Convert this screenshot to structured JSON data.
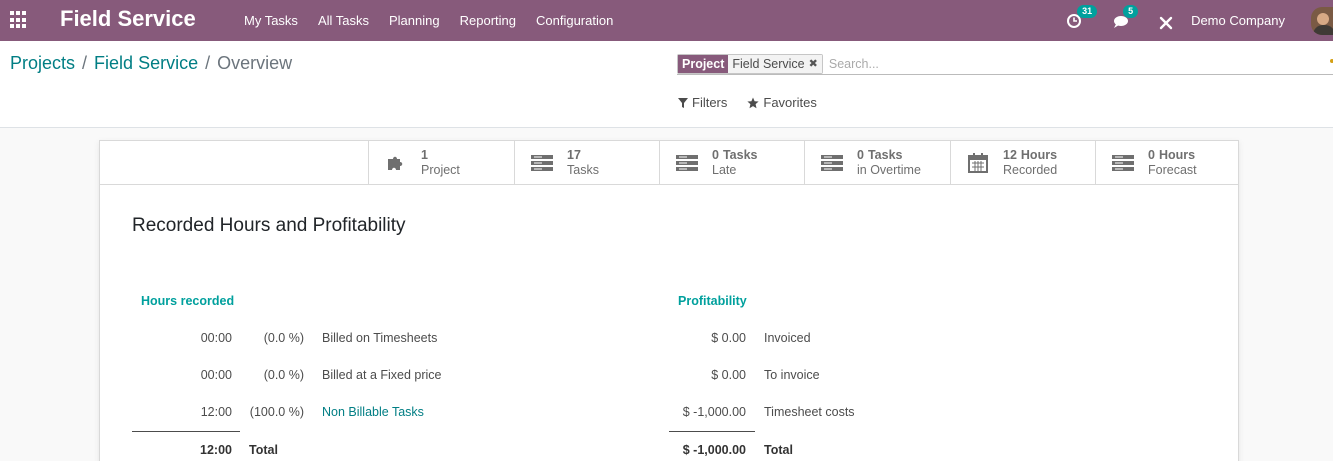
{
  "navbar": {
    "brand": "Field Service",
    "menu": [
      "My Tasks",
      "All Tasks",
      "Planning",
      "Reporting",
      "Configuration"
    ],
    "activity_count": "31",
    "messages_count": "5",
    "company": "Demo Company"
  },
  "breadcrumb": {
    "items": [
      "Projects",
      "Field Service"
    ],
    "separator": "/",
    "current": "Overview"
  },
  "search": {
    "facet_label": "Project",
    "facet_value": "Field Service",
    "placeholder": "Search..."
  },
  "filter_buttons": {
    "filters": "Filters",
    "favorites": "Favorites"
  },
  "stats": [
    {
      "num": "1",
      "label": "Project",
      "icon": "puzzle-icon"
    },
    {
      "num": "17",
      "label": "Tasks",
      "icon": "tasks-icon"
    },
    {
      "num": "0",
      "label": "Tasks",
      "label2": "Late",
      "icon": "tasks-icon"
    },
    {
      "num": "0",
      "label": "Tasks",
      "label2": "in Overtime",
      "icon": "tasks-icon"
    },
    {
      "num": "12",
      "label": "Hours",
      "label2": "Recorded",
      "icon": "calendar-icon"
    },
    {
      "num": "0",
      "label": "Hours",
      "label2": "Forecast",
      "icon": "tasks-icon"
    }
  ],
  "report": {
    "title": "Recorded Hours and Profitability",
    "hours": {
      "heading": "Hours recorded",
      "rows": [
        {
          "value": "00:00",
          "pct": "(0.0 %)",
          "label": "Billed on Timesheets"
        },
        {
          "value": "00:00",
          "pct": "(0.0 %)",
          "label": "Billed at a Fixed price"
        },
        {
          "value": "12:00",
          "pct": "(100.0 %)",
          "label": "Non Billable Tasks"
        }
      ],
      "total_value": "12:00",
      "total_label": "Total"
    },
    "profit": {
      "heading": "Profitability",
      "rows": [
        {
          "value": "$ 0.00",
          "label": "Invoiced"
        },
        {
          "value": "$ 0.00",
          "label": "To invoice"
        },
        {
          "value": "$ -1,000.00",
          "label": "Timesheet costs"
        }
      ],
      "total_value": "$ -1,000.00",
      "total_label": "Total"
    }
  },
  "colors": {
    "navbar": "#875a7b",
    "accent": "#00a09d",
    "link": "#017e84"
  }
}
